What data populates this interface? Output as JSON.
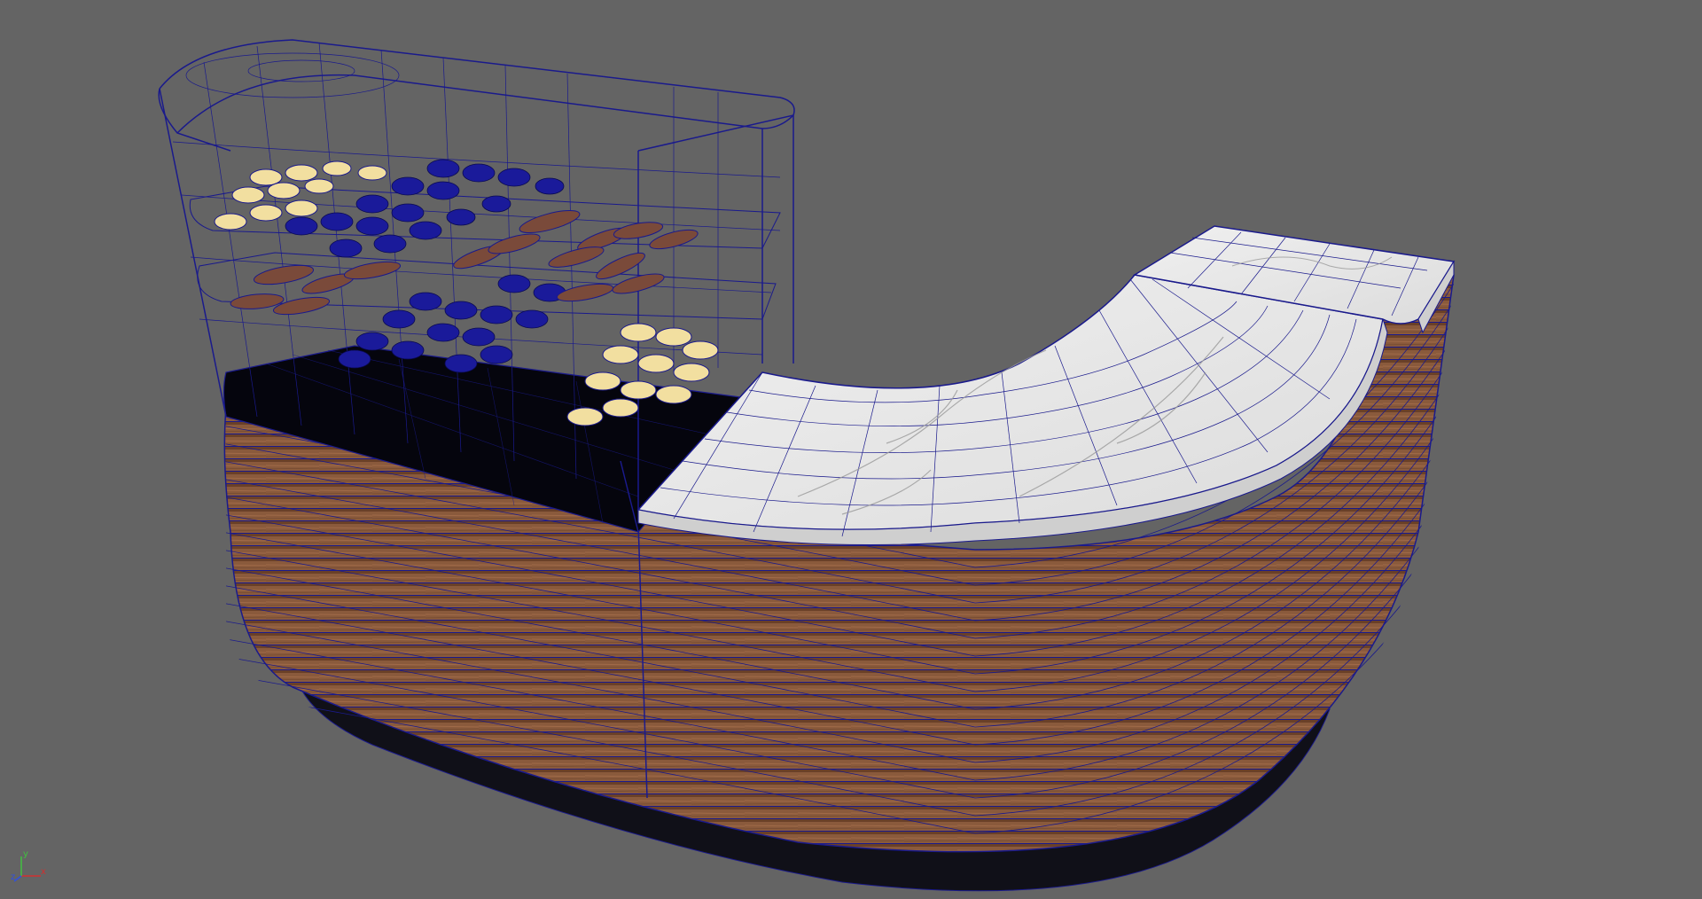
{
  "viewport": {
    "background": "#646464",
    "wire_color": "#1a1a8c",
    "wood_color": "#8a5a3c",
    "wood_dark": "#5e3a26",
    "marble_color": "#e6e6e6",
    "base_color": "#101018",
    "cookie_color": "#f2dfa0",
    "gizmo": {
      "x_label": "x",
      "y_label": "y",
      "z_label": "z",
      "x_color": "#d03030",
      "y_color": "#40c040",
      "z_color": "#3050e0"
    }
  }
}
